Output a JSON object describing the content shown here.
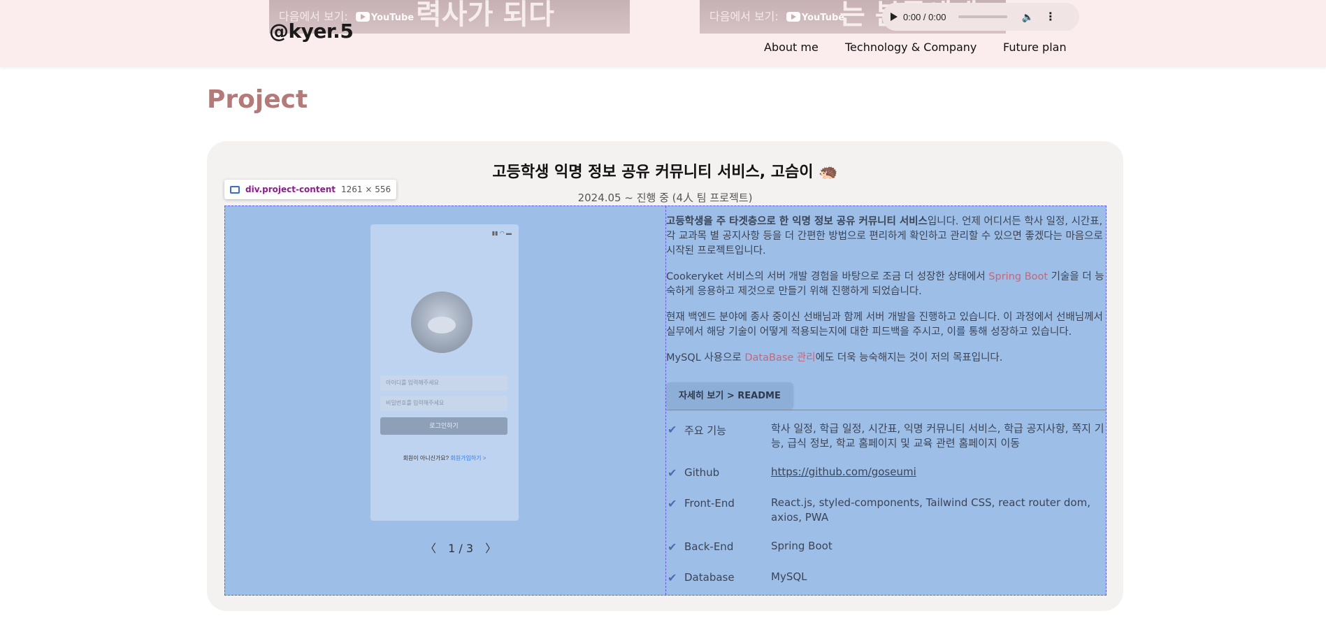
{
  "header": {
    "video1": {
      "watch_label": "다음에서 보기:",
      "brand": "YouTube",
      "big_text": "력사가 되다"
    },
    "video2": {
      "watch_label": "다음에서 보기:",
      "brand": "YouTube",
      "big_text": "는 분들에게"
    },
    "audio": {
      "time": "0:00 / 0:00"
    },
    "logo": "@kyer.5",
    "nav": [
      "About me",
      "Technology & Company",
      "Future plan"
    ]
  },
  "section_title": "Project",
  "project": {
    "title": "고등학생 익명 정보 공유 커뮤니티 서비스, 고슴이 🦔",
    "subtitle": "2024.05 ~ 진행 중 (4人 팀 프로젝트)",
    "devtools_tooltip": {
      "name": "div.project-content",
      "size": "1261 × 556"
    },
    "mockup": {
      "id_placeholder": "아이디를 입력해주세요",
      "pw_placeholder": "비밀번호를 입력해주세요",
      "login_label": "로그인하기",
      "signup_prompt": "회원이 아니신가요?",
      "signup_link": "회원가입하기 >"
    },
    "pager": {
      "prev": "〈",
      "current": "1 / 3",
      "next": "〉"
    },
    "description": {
      "p1_bold": "고등학생을 주 타겟층으로 한 익명 정보 공유 커뮤니티 서비스",
      "p1_rest": "입니다. 언제 어디서든 학사 일정, 시간표, 각 교과목 별 공지사항 등을 더 간편한 방법으로 편리하게 확인하고 관리할 수 있으면 좋겠다는 마음으로 시작된 프로젝트입니다.",
      "p2_a": "Cookeryket 서비스의 서버 개발 경험을 바탕으로 조금 더 성장한 상태에서 ",
      "p2_accent": "Spring Boot",
      "p2_b": " 기술을 더 능숙하게 응용하고 제것으로 만들기 위해 진행하게 되었습니다.",
      "p3": "현재 백엔드 분야에 종사 중이신 선배님과 함께 서버 개발을 진행하고 있습니다. 이 과정에서 선배님께서 실무에서 해당 기술이 어떻게 적용되는지에 대한 피드백을 주시고, 이를 통해 성장하고 있습니다.",
      "p4_a": "MySQL 사용으로 ",
      "p4_accent": "DataBase 관리",
      "p4_b": "에도 더욱 능숙해지는 것이 저의 목표입니다."
    },
    "readme_button": "자세히 보기 > README",
    "info": [
      {
        "label": "주요 기능",
        "value": "학사 일정, 학급 일정, 시간표, 익명 커뮤니티 서비스, 학급 공지사항, 쪽지 기능, 급식 정보, 학교 홈페이지 및 교육 관련 홈페이지 이동"
      },
      {
        "label": "Github",
        "value": "https://github.com/goseumi"
      },
      {
        "label": "Front-End",
        "value": "React.js, styled-components, Tailwind CSS, react router dom, axios, PWA"
      },
      {
        "label": "Back-End",
        "value": "Spring Boot"
      },
      {
        "label": "Database",
        "value": "MySQL"
      }
    ],
    "check_icon": "✔"
  }
}
